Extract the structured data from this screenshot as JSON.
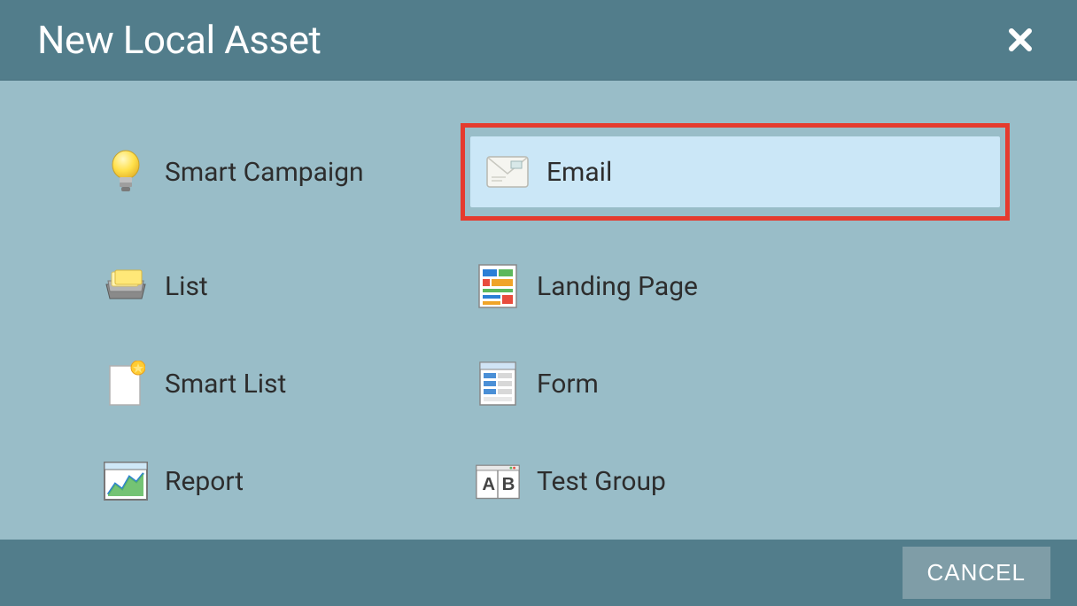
{
  "dialog": {
    "title": "New Local Asset",
    "close_aria": "Close"
  },
  "assets": {
    "smart_campaign": {
      "label": "Smart Campaign"
    },
    "email": {
      "label": "Email",
      "selected": true
    },
    "list": {
      "label": "List"
    },
    "landing_page": {
      "label": "Landing Page"
    },
    "smart_list": {
      "label": "Smart List"
    },
    "form": {
      "label": "Form"
    },
    "report": {
      "label": "Report"
    },
    "test_group": {
      "label": "Test Group"
    }
  },
  "footer": {
    "cancel_label": "CANCEL"
  }
}
